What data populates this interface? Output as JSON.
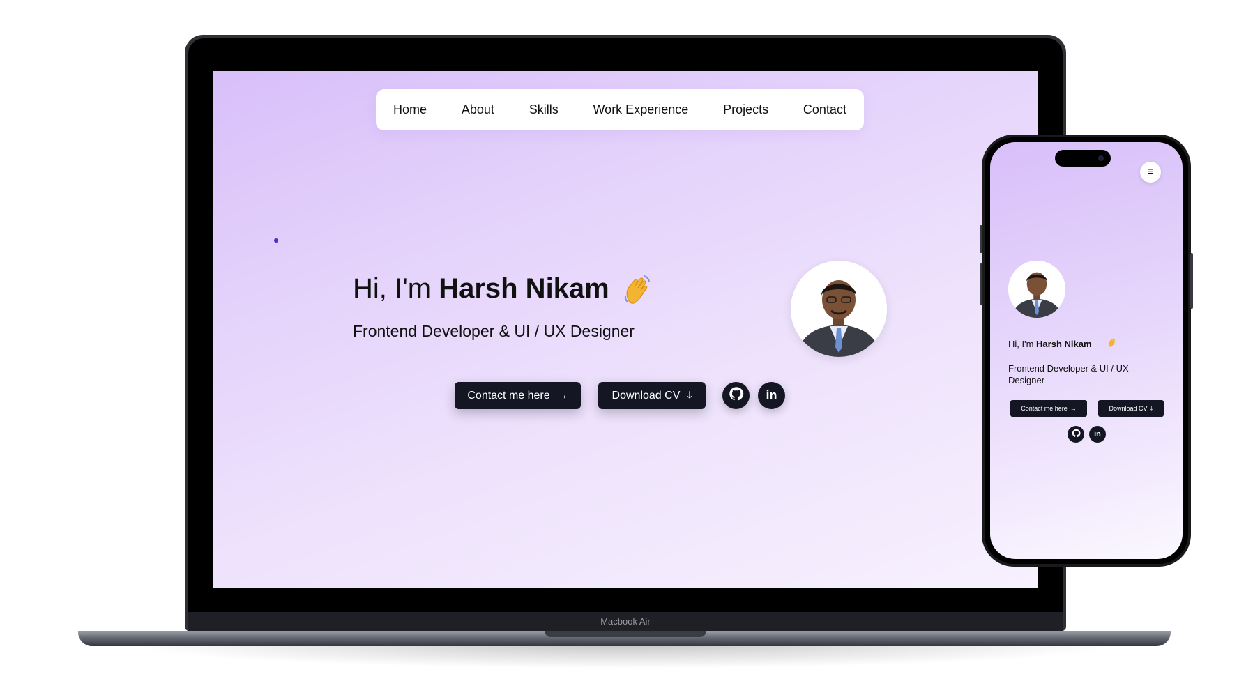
{
  "laptop": {
    "model_label": "Macbook Air",
    "nav": {
      "items": [
        "Home",
        "About",
        "Skills",
        "Work Experience",
        "Projects",
        "Contact"
      ]
    },
    "hero": {
      "greeting": "Hi, I'm ",
      "name": "Harsh Nikam",
      "wave_icon": "waving-hand-icon",
      "subtitle": "Frontend Developer & UI / UX Designer",
      "contact_label": "Contact me here",
      "contact_arrow": "→",
      "download_label": "Download CV",
      "download_icon": "⤓"
    },
    "social": {
      "github_icon": "github-icon",
      "linkedin_label": "in"
    }
  },
  "phone": {
    "menu_icon": "≡",
    "hero": {
      "greeting": "Hi, I'm ",
      "name": "Harsh Nikam",
      "subtitle": "Frontend Developer & UI / UX Designer",
      "contact_label": "Contact me here",
      "contact_arrow": "→",
      "download_label": "Download CV",
      "download_icon": "⤓"
    },
    "social": {
      "linkedin_label": "in"
    }
  },
  "colors": {
    "accent_dark": "#141624",
    "gradient_top": "#d8bff9",
    "gradient_bottom": "#f7f1fe",
    "wave": "#f3b431"
  }
}
